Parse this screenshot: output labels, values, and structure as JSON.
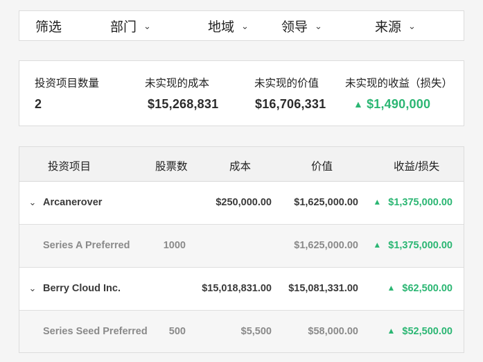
{
  "filters": {
    "title": "筛选",
    "items": [
      {
        "label": "部门"
      },
      {
        "label": "地域"
      },
      {
        "label": "领导"
      },
      {
        "label": "来源"
      }
    ]
  },
  "summary": {
    "count_label": "投资项目数量",
    "count_value": "2",
    "cost_label": "未实现的成本",
    "cost_value": "$15,268,831",
    "value_label": "未实现的价值",
    "value_value": "$16,706,331",
    "gain_label": "未实现的收益（损失）",
    "gain_value": "$1,490,000"
  },
  "table": {
    "headers": {
      "project": "投资项目",
      "shares": "股票数",
      "cost": "成本",
      "value": "价值",
      "gain": "收益/损失"
    },
    "rows": [
      {
        "type": "parent",
        "name": "Arcanerover",
        "shares": "",
        "cost": "$250,000.00",
        "value": "$1,625,000.00",
        "gain": "$1,375,000.00"
      },
      {
        "type": "child",
        "name": "Series A Preferred",
        "shares": "1000",
        "cost": "",
        "value": "$1,625,000.00",
        "gain": "$1,375,000.00"
      },
      {
        "type": "parent",
        "name": "Berry Cloud Inc.",
        "shares": "",
        "cost": "$15,018,831.00",
        "value": "$15,081,331.00",
        "gain": "$62,500.00"
      },
      {
        "type": "child",
        "name": "Series Seed Preferred",
        "shares": "500",
        "cost": "$5,500",
        "value": "$58,000.00",
        "gain": "$52,500.00"
      }
    ]
  },
  "icons": {
    "chevron": "chevron-down-icon",
    "gain": "triangle-up-icon"
  },
  "colors": {
    "gain": "#2bb673",
    "border": "#dcdcdc",
    "header_bg": "#f2f2f2",
    "child_bg": "#f6f6f6"
  }
}
